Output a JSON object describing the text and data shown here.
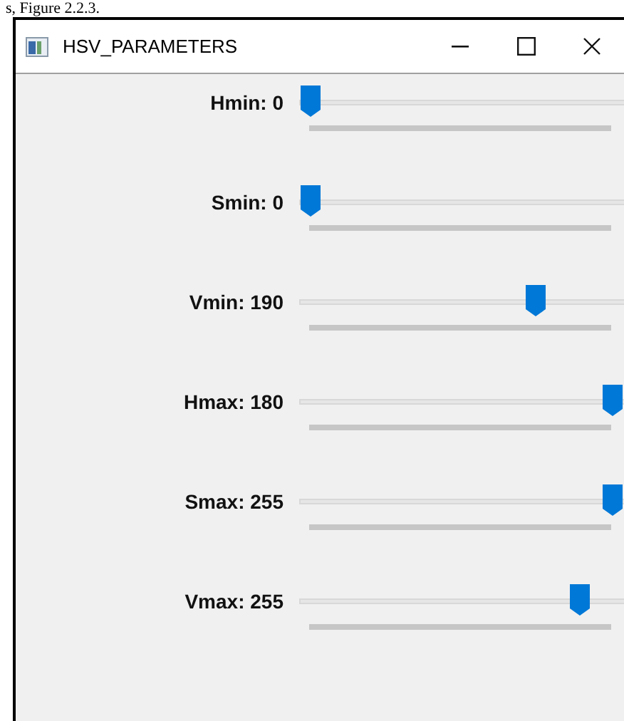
{
  "caption_fragment": "s, Figure 2.2.3.",
  "window": {
    "title": "HSV_PARAMETERS"
  },
  "sliders": [
    {
      "label": "Hmin: 0",
      "level": 0
    },
    {
      "label": "Smin: 0",
      "level": 0
    },
    {
      "label": "Vmin: 190",
      "level": 0.745
    },
    {
      "label": "Hmax: 180",
      "level": 1
    },
    {
      "label": "Smax: 255",
      "level": 1
    },
    {
      "label": "Vmax: 255",
      "level": 0.89
    }
  ]
}
